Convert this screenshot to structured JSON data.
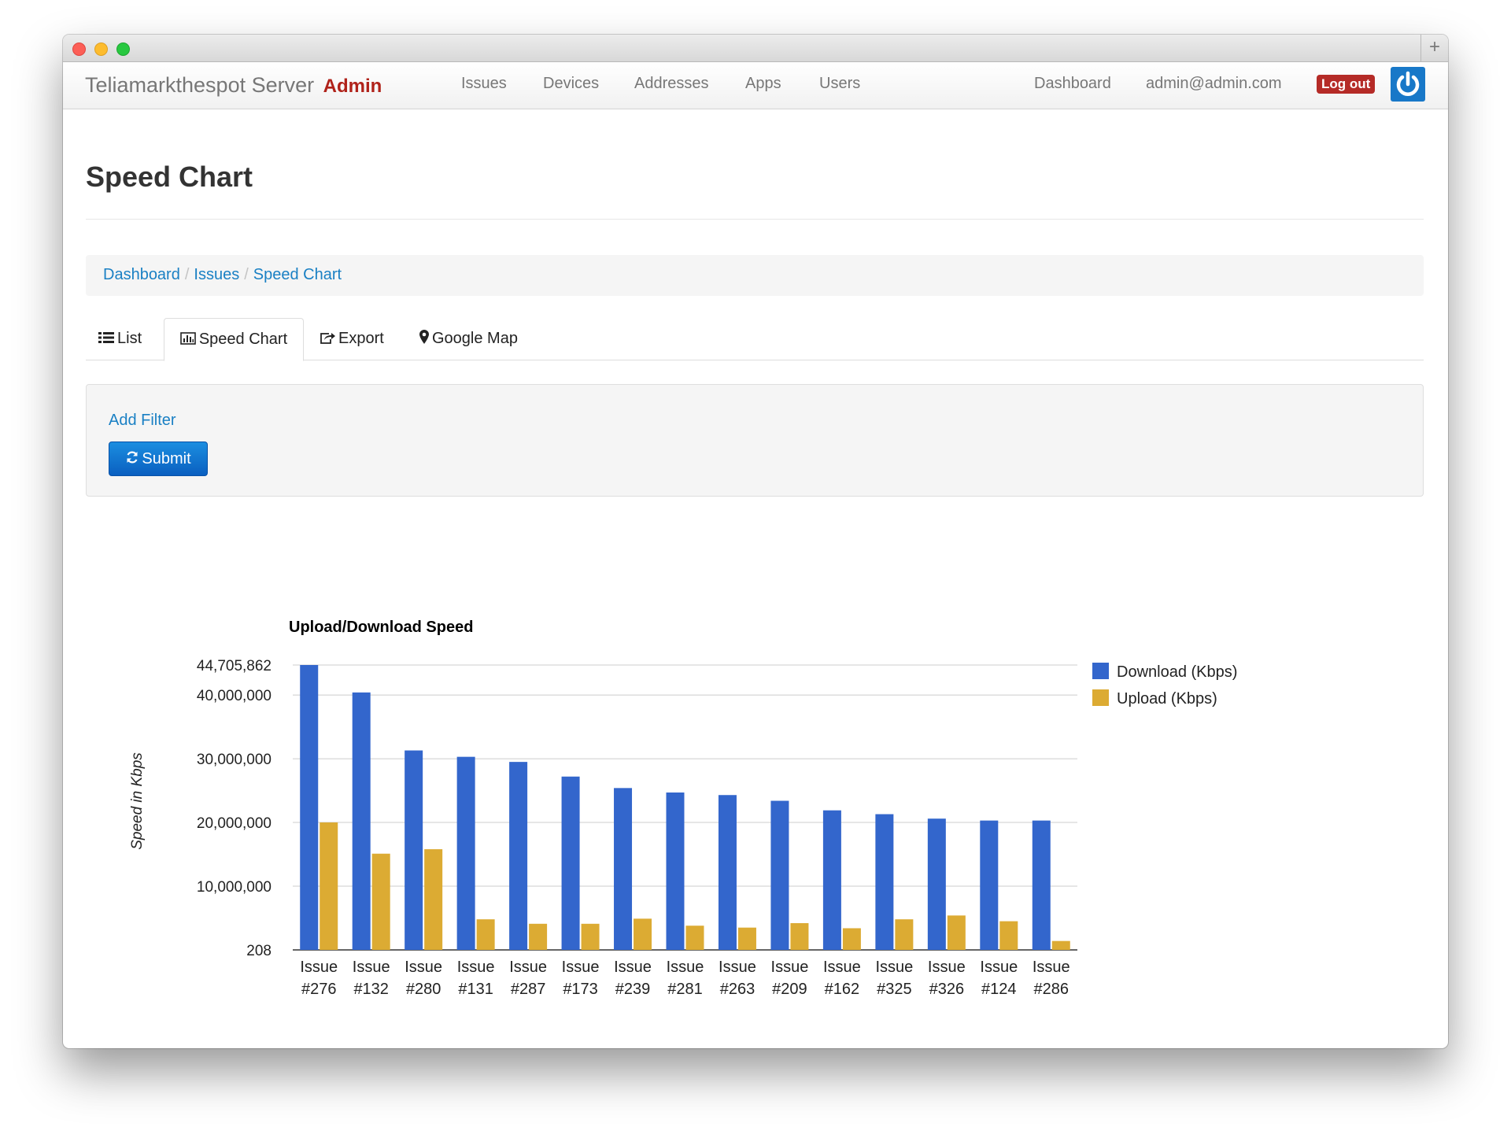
{
  "brand": {
    "name": "Teliamarkthespot Server",
    "suffix": "Admin"
  },
  "nav": {
    "left": [
      "Issues",
      "Devices",
      "Addresses",
      "Apps",
      "Users"
    ],
    "dashboard": "Dashboard",
    "user": "admin@admin.com",
    "logout": "Log out"
  },
  "page": {
    "title": "Speed Chart"
  },
  "breadcrumb": [
    "Dashboard",
    "Issues",
    "Speed Chart"
  ],
  "tabs": [
    {
      "label": "List",
      "icon": "list-icon"
    },
    {
      "label": "Speed Chart",
      "icon": "bar-chart-icon",
      "active": true
    },
    {
      "label": "Export",
      "icon": "share-icon"
    },
    {
      "label": "Google Map",
      "icon": "map-marker-icon"
    }
  ],
  "filter": {
    "add_filter": "Add Filter",
    "submit": "Submit"
  },
  "colors": {
    "download": "#3366cc",
    "upload": "#dcab33",
    "link": "#1a80c4",
    "danger": "#b52b27"
  },
  "chart_data": {
    "type": "bar",
    "title": "Upload/Download Speed",
    "ylabel": "Speed in Kbps",
    "xlabel": "",
    "ylim": [
      208,
      44705862
    ],
    "yticks": [
      208,
      10000000,
      20000000,
      30000000,
      40000000,
      44705862
    ],
    "ytick_labels": [
      "208",
      "10,000,000",
      "20,000,000",
      "30,000,000",
      "40,000,000",
      "44,705,862"
    ],
    "legend_position": "right",
    "grid": true,
    "categories": [
      "Issue #276",
      "Issue #132",
      "Issue #280",
      "Issue #131",
      "Issue #287",
      "Issue #173",
      "Issue #239",
      "Issue #281",
      "Issue #263",
      "Issue #209",
      "Issue #162",
      "Issue #325",
      "Issue #326",
      "Issue #124",
      "Issue #286"
    ],
    "series": [
      {
        "name": "Download (Kbps)",
        "values": [
          44705862,
          40400000,
          31300000,
          30300000,
          29500000,
          27200000,
          25400000,
          24700000,
          24300000,
          23400000,
          21900000,
          21300000,
          20600000,
          20300000,
          20300000
        ]
      },
      {
        "name": "Upload (Kbps)",
        "values": [
          20000000,
          15100000,
          15800000,
          4800000,
          4100000,
          4100000,
          4900000,
          3800000,
          3500000,
          4200000,
          3400000,
          4800000,
          5400000,
          4500000,
          1400000
        ]
      }
    ]
  }
}
